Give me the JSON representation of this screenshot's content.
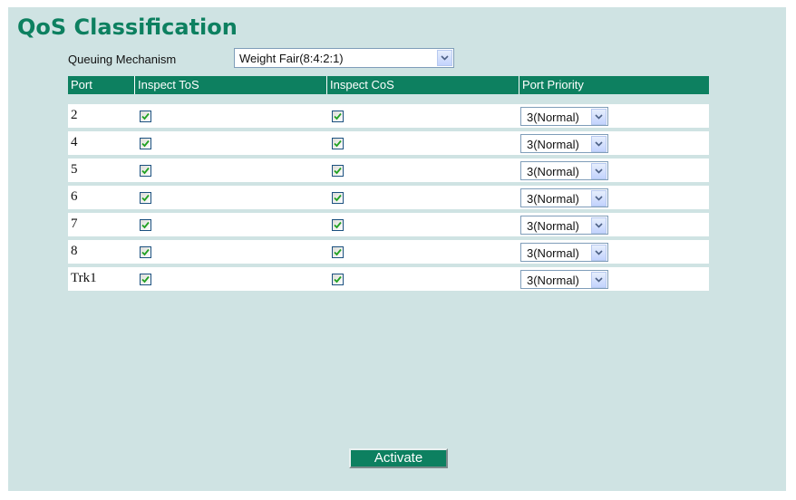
{
  "page": {
    "title": "QoS Classification"
  },
  "queuing": {
    "label": "Queuing Mechanism",
    "selected": "Weight Fair(8:4:2:1)"
  },
  "table": {
    "headers": [
      "Port",
      "Inspect ToS",
      "Inspect CoS",
      "Port Priority"
    ],
    "rows": [
      {
        "port": "2",
        "inspect_tos": true,
        "inspect_cos": true,
        "priority": "3(Normal)"
      },
      {
        "port": "4",
        "inspect_tos": true,
        "inspect_cos": true,
        "priority": "3(Normal)"
      },
      {
        "port": "5",
        "inspect_tos": true,
        "inspect_cos": true,
        "priority": "3(Normal)"
      },
      {
        "port": "6",
        "inspect_tos": true,
        "inspect_cos": true,
        "priority": "3(Normal)"
      },
      {
        "port": "7",
        "inspect_tos": true,
        "inspect_cos": true,
        "priority": "3(Normal)"
      },
      {
        "port": "8",
        "inspect_tos": true,
        "inspect_cos": true,
        "priority": "3(Normal)"
      },
      {
        "port": "Trk1",
        "inspect_tos": true,
        "inspect_cos": true,
        "priority": "3(Normal)"
      }
    ]
  },
  "actions": {
    "activate_label": "Activate"
  },
  "colors": {
    "accent": "#0d8060",
    "panel_bg": "#cfe3e3",
    "checkbox_check": "#21a121"
  }
}
